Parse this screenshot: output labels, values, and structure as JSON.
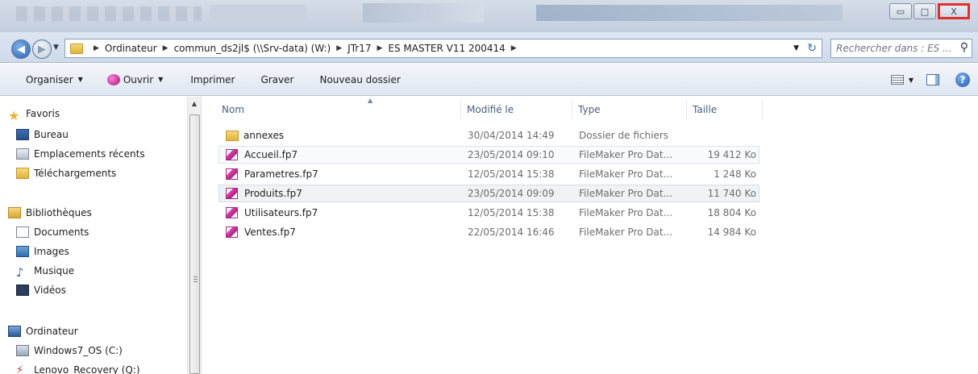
{
  "window": {
    "buttons": [
      "minimize",
      "maximize",
      "close"
    ],
    "close_symbol": "X"
  },
  "address": {
    "crumbs": [
      "Ordinateur",
      "commun_ds2jl$ (\\\\Srv-data) (W:)",
      "JTr17",
      "ES MASTER V11 200414"
    ],
    "back_icon": "back-arrow-icon",
    "forward_icon": "forward-arrow-icon"
  },
  "search": {
    "placeholder": "Rechercher dans : ES ..."
  },
  "toolbar": {
    "organiser": "Organiser",
    "ouvrir": "Ouvrir",
    "imprimer": "Imprimer",
    "graver": "Graver",
    "nouveau_dossier": "Nouveau dossier"
  },
  "nav": {
    "favoris": "Favoris",
    "bureau": "Bureau",
    "emplacements": "Emplacements récents",
    "telechargements": "Téléchargements",
    "bibliotheques": "Bibliothèques",
    "documents": "Documents",
    "images": "Images",
    "musique": "Musique",
    "videos": "Vidéos",
    "ordinateur": "Ordinateur",
    "windows7": "Windows7_OS (C:)",
    "lenovo": "Lenovo_Recovery (Q:)"
  },
  "columns": {
    "nom": "Nom",
    "modifie": "Modifié le",
    "type": "Type",
    "taille": "Taille"
  },
  "files": [
    {
      "name": "annexes",
      "date": "30/04/2014 14:49",
      "type": "Dossier de fichiers",
      "size": ""
    },
    {
      "name": "Accueil.fp7",
      "date": "23/05/2014 09:10",
      "type": "FileMaker Pro Dat...",
      "size": "19 412 Ko"
    },
    {
      "name": "Parametres.fp7",
      "date": "12/05/2014 15:38",
      "type": "FileMaker Pro Dat...",
      "size": "1 248 Ko"
    },
    {
      "name": "Produits.fp7",
      "date": "23/05/2014 09:09",
      "type": "FileMaker Pro Dat...",
      "size": "11 740 Ko"
    },
    {
      "name": "Utilisateurs.fp7",
      "date": "12/05/2014 15:38",
      "type": "FileMaker Pro Dat...",
      "size": "18 804 Ko"
    },
    {
      "name": "Ventes.fp7",
      "date": "22/05/2014 16:46",
      "type": "FileMaker Pro Dat...",
      "size": "14 984 Ko"
    }
  ],
  "colors": {
    "close_highlight": "#e0302a",
    "toolbar_bg": "#dde6f1"
  }
}
